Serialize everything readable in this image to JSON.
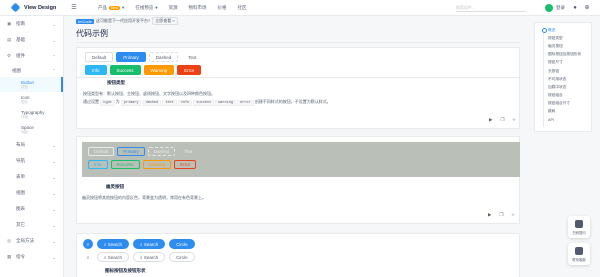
{
  "header": {
    "logo_text": "View Design",
    "menu_icon": "menu-icon",
    "nav": [
      {
        "label": "产品",
        "badge": "New"
      },
      {
        "label": "在线预览"
      },
      {
        "label": "资源"
      },
      {
        "label": "物料市场"
      },
      {
        "label": "价格"
      },
      {
        "label": "社区"
      }
    ],
    "search_placeholder": "搜索组件...",
    "login": "登录"
  },
  "announcement": {
    "tag": "ImCode",
    "text": "这可能是下一代应用开发平台?",
    "button": "立即查看 >"
  },
  "sidebar": {
    "groups_top": [
      {
        "label": "指南"
      },
      {
        "label": "基础"
      },
      {
        "label": "组件"
      }
    ],
    "sub": "视图",
    "items": [
      {
        "en": "Button",
        "zh": "按钮",
        "active": true
      },
      {
        "en": "Icon",
        "zh": "图标"
      },
      {
        "en": "Typography",
        "zh": "排版"
      },
      {
        "en": "Space",
        "zh": "间距"
      }
    ],
    "groups_bottom": [
      {
        "label": "布局"
      },
      {
        "label": "导航"
      },
      {
        "label": "表单"
      },
      {
        "label": "视图"
      },
      {
        "label": "图表"
      },
      {
        "label": "其它"
      },
      {
        "label": "全局方法"
      },
      {
        "label": "指令"
      }
    ]
  },
  "page": {
    "title": "代码示例"
  },
  "demo1": {
    "buttons_row1": [
      "Default",
      "Primary",
      "Dashed",
      "Text"
    ],
    "buttons_row2": [
      "Info",
      "Success",
      "Warning",
      "Error"
    ],
    "section": "按钮类型",
    "desc1_a": "按钮类型有：默认按钮、主按钮、虚线按钮、文字按钮以及四种颜色按钮。",
    "desc2_a": "通过设置",
    "desc2_type": "type",
    "desc2_b": "为",
    "codes": [
      "primary",
      "dashed",
      "text",
      "info",
      "success",
      "warning",
      "error"
    ],
    "desc2_c": "创建不同样式的按钮，不设置为默认样式。"
  },
  "demo2": {
    "buttons_row1": [
      "Default",
      "Primary",
      "Dashed",
      "Text"
    ],
    "buttons_row2": [
      "Info",
      "Success",
      "Warning",
      "Error"
    ],
    "section": "幽灵按钮",
    "desc": "幽灵按钮将其他按钮的内容反色，背景变为透明，常用在有色背景上。"
  },
  "demo3": {
    "row1": [
      "Search",
      "Search",
      "Circle"
    ],
    "row2": [
      "Search",
      "Search",
      "Circle"
    ],
    "section": "图标按钮及按钮形状"
  },
  "anchor": [
    {
      "label": "概述",
      "active": true
    },
    {
      "label": "按钮类型"
    },
    {
      "label": "幽灵按钮"
    },
    {
      "label": "图标按钮及按钮形状"
    },
    {
      "label": "按钮尺寸"
    },
    {
      "label": "长按钮"
    },
    {
      "label": "不可用状态"
    },
    {
      "label": "加载中状态"
    },
    {
      "label": "按钮组合"
    },
    {
      "label": "按钮组合尺寸"
    },
    {
      "label": "跳转"
    },
    {
      "label": "API"
    }
  ],
  "float": [
    {
      "label": "扫码提问"
    },
    {
      "label": "联系客服"
    }
  ],
  "colors": {
    "primary": "#2d8cf0",
    "info": "#2db7f5",
    "success": "#19be6b",
    "warning": "#ff9900",
    "error": "#ed4014"
  }
}
